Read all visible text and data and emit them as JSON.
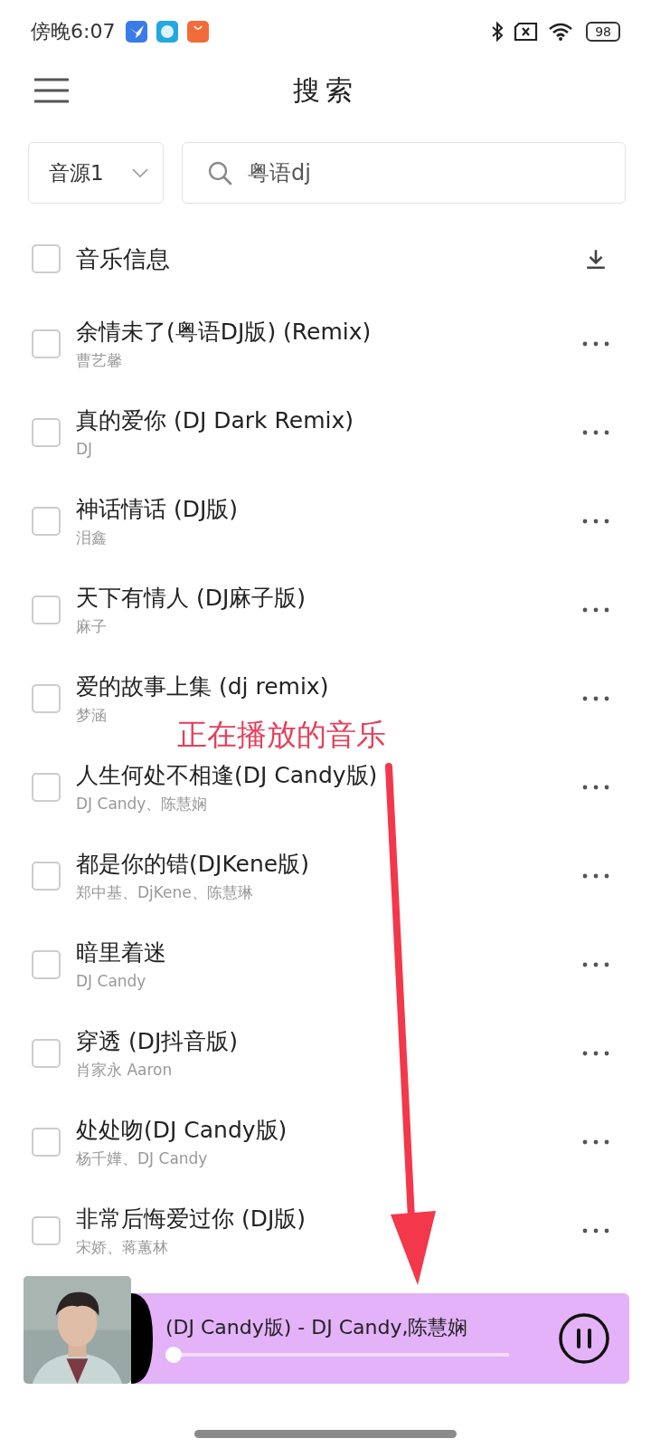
{
  "status_bar": {
    "time": "傍晚6:07",
    "battery": "98"
  },
  "header": {
    "title": "搜索"
  },
  "search": {
    "source": "音源1",
    "value": "粤语dj"
  },
  "list_header": {
    "label": "音乐信息",
    "checked": false
  },
  "songs": [
    {
      "title": "余情未了(粤语DJ版) (Remix)",
      "artist": "曹艺馨",
      "checked": false
    },
    {
      "title": "真的爱你 (DJ Dark Remix)",
      "artist": "DJ",
      "checked": false
    },
    {
      "title": "神话情话 (DJ版)",
      "artist": "泪鑫",
      "checked": false
    },
    {
      "title": "天下有情人 (DJ麻子版)",
      "artist": "麻子",
      "checked": false
    },
    {
      "title": "爱的故事上集 (dj remix)",
      "artist": "梦涵",
      "checked": false
    },
    {
      "title": "人生何处不相逢(DJ Candy版)",
      "artist": "DJ Candy、陈慧娴",
      "checked": false
    },
    {
      "title": "都是你的错(DJKene版)",
      "artist": "郑中基、DjKene、陈慧琳",
      "checked": false
    },
    {
      "title": "暗里着迷",
      "artist": "DJ Candy",
      "checked": false
    },
    {
      "title": "穿透 (DJ抖音版)",
      "artist": "肖家永 Aaron",
      "checked": false
    },
    {
      "title": "处处吻(DJ Candy版)",
      "artist": "杨千嬅、DJ Candy",
      "checked": false
    },
    {
      "title": "非常后悔爱过你 (DJ版)",
      "artist": "宋娇、蒋蕙林",
      "checked": false
    }
  ],
  "player": {
    "now_playing": "(DJ Candy版) - DJ Candy,陈慧娴",
    "level": 0.0,
    "playing": true
  },
  "annotation": {
    "text": "正在播放的音乐"
  }
}
